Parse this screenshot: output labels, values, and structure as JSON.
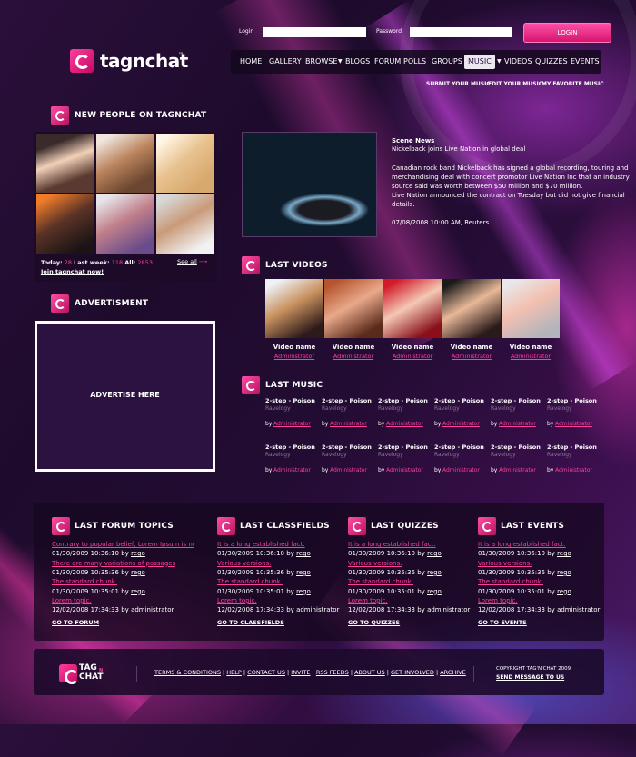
{
  "brand": {
    "name": "tagnchat",
    "tm": "™"
  },
  "login": {
    "login_label": "Login",
    "password_label": "Password",
    "button": "LOGIN"
  },
  "nav": [
    "HOME",
    "GALLERY",
    "BROWSE",
    "BLOGS",
    "FORUM",
    "POLLS",
    "GROUPS",
    "MUSIC",
    "VIDEOS",
    "QUIZZES",
    "EVENTS"
  ],
  "subnav": [
    "SUBMIT YOUR MUSIC",
    "EDIT YOUR MUSIC",
    "MY FAVORITE MUSIC"
  ],
  "new_people": {
    "title": "NEW PEOPLE ON TAGNCHAT",
    "today_label": "Today:",
    "today_value": "28",
    "week_label": "Last week:",
    "week_value": "118",
    "all_label": "All:",
    "all_value": "2853",
    "see_all": "See all",
    "join": "Join tagnchat now!"
  },
  "advert": {
    "title": "ADVERTISMENT",
    "placeholder": "ADVERTISE HERE"
  },
  "news": {
    "category": "Scene News",
    "headline": "Nickelback joins Live Nation in global deal",
    "body_lines": [
      "Canadian rock band Nickelback has signed a global recording, touring and",
      "merchandising deal with concert promotor Live Nation Inc that an industry",
      "source said was worth between $50 million and $70 million.",
      "Live Nation announced the contract on Tuesday but did not give financial",
      "details."
    ],
    "dateline": "07/08/2008 10:00 AM, Reuters"
  },
  "videos": {
    "title": "LAST VIDEOS",
    "items": [
      {
        "name": "Video name",
        "author": "Administrator"
      },
      {
        "name": "Video name",
        "author": "Administrator"
      },
      {
        "name": "Video name",
        "author": "Administrator"
      },
      {
        "name": "Video name",
        "author": "Administrator"
      },
      {
        "name": "Video name",
        "author": "Administrator"
      }
    ]
  },
  "music": {
    "title": "LAST MUSIC",
    "track": "2-step - Poison",
    "artist": "Ravelogy",
    "by": "by",
    "author": "Administrator"
  },
  "forum": {
    "title": "LAST FORUM TOPICS",
    "lines": [
      {
        "type": "link",
        "text": "Contrary to popular belief, Lorem Ipsum is not sim"
      },
      {
        "type": "meta",
        "text": "01/30/2009 10:36:10 by",
        "user": "rego"
      },
      {
        "type": "link",
        "text": "There are many variations of passages"
      },
      {
        "type": "meta",
        "text": "01/30/2009 10:35:36 by",
        "user": "rego"
      },
      {
        "type": "link",
        "text": "The standard chunk."
      },
      {
        "type": "meta",
        "text": "01/30/2009 10:35:01 by",
        "user": "rego"
      },
      {
        "type": "link",
        "text": "Lorem topic."
      },
      {
        "type": "meta",
        "text": "12/02/2008 17:34:33 by",
        "user": "administrator"
      }
    ],
    "go": "GO TO FORUM"
  },
  "classifields": {
    "title": "LAST CLASSFIELDS",
    "lines": [
      {
        "type": "link",
        "text": "It is a long established fact."
      },
      {
        "type": "meta",
        "text": "01/30/2009 10:36:10 by",
        "user": "rego"
      },
      {
        "type": "link",
        "text": "Various versions."
      },
      {
        "type": "meta",
        "text": "01/30/2009 10:35:36 by",
        "user": "rego"
      },
      {
        "type": "link",
        "text": "The standard chunk."
      },
      {
        "type": "meta",
        "text": "01/30/2009 10:35:01 by",
        "user": "rego"
      },
      {
        "type": "link",
        "text": "Lorem topic."
      },
      {
        "type": "meta",
        "text": "12/02/2008 17:34:33 by",
        "user": "administrator"
      }
    ],
    "go": "GO TO CLASSFIELDS"
  },
  "quizzes": {
    "title": "LAST QUIZZES",
    "lines": [
      {
        "type": "link",
        "text": "It is a long established fact."
      },
      {
        "type": "meta",
        "text": "01/30/2009 10:36:10 by",
        "user": "rego"
      },
      {
        "type": "link",
        "text": "Various versions."
      },
      {
        "type": "meta",
        "text": "01/30/2009 10:35:36 by",
        "user": "rego"
      },
      {
        "type": "link",
        "text": "The standard chunk."
      },
      {
        "type": "meta",
        "text": "01/30/2009 10:35:01 by",
        "user": "rego"
      },
      {
        "type": "link",
        "text": "Lorem topic."
      },
      {
        "type": "meta",
        "text": "12/02/2008 17:34:33 by",
        "user": "administrator"
      }
    ],
    "go": "GO TO QUIZZES"
  },
  "events": {
    "title": "LAST EVENTS",
    "lines": [
      {
        "type": "link",
        "text": "It is a long established fact."
      },
      {
        "type": "meta",
        "text": "01/30/2009 10:36:10 by",
        "user": "rego"
      },
      {
        "type": "link",
        "text": "Various versions."
      },
      {
        "type": "meta",
        "text": "01/30/2009 10:35:36 by",
        "user": "rego"
      },
      {
        "type": "link",
        "text": "The standard chunk."
      },
      {
        "type": "meta",
        "text": "01/30/2009 10:35:01 by",
        "user": "rego"
      },
      {
        "type": "link",
        "text": "Lorem topic."
      },
      {
        "type": "meta",
        "text": "12/02/2008 17:34:33 by",
        "user": "administrator"
      }
    ],
    "go": "GO TO EVENTS"
  },
  "footer": {
    "logo_top": "TAG",
    "logo_bottom": "CHAT",
    "logo_mid": "N",
    "links": [
      "TERMS & CONDITIONS",
      "HELP",
      "CONTACT US",
      "INVITE",
      "RSS FEEDS",
      "ABOUT US",
      "GET INVOLVED",
      "ARCHIVE"
    ],
    "copyright": "COPYRIGHT TAG'N'CHAT 2009",
    "send": "SEND MESSAGE TO US"
  },
  "colors": {
    "accent": "#ff3e9c",
    "bg": "#1e0b2c",
    "panel": "#1c0a28"
  }
}
